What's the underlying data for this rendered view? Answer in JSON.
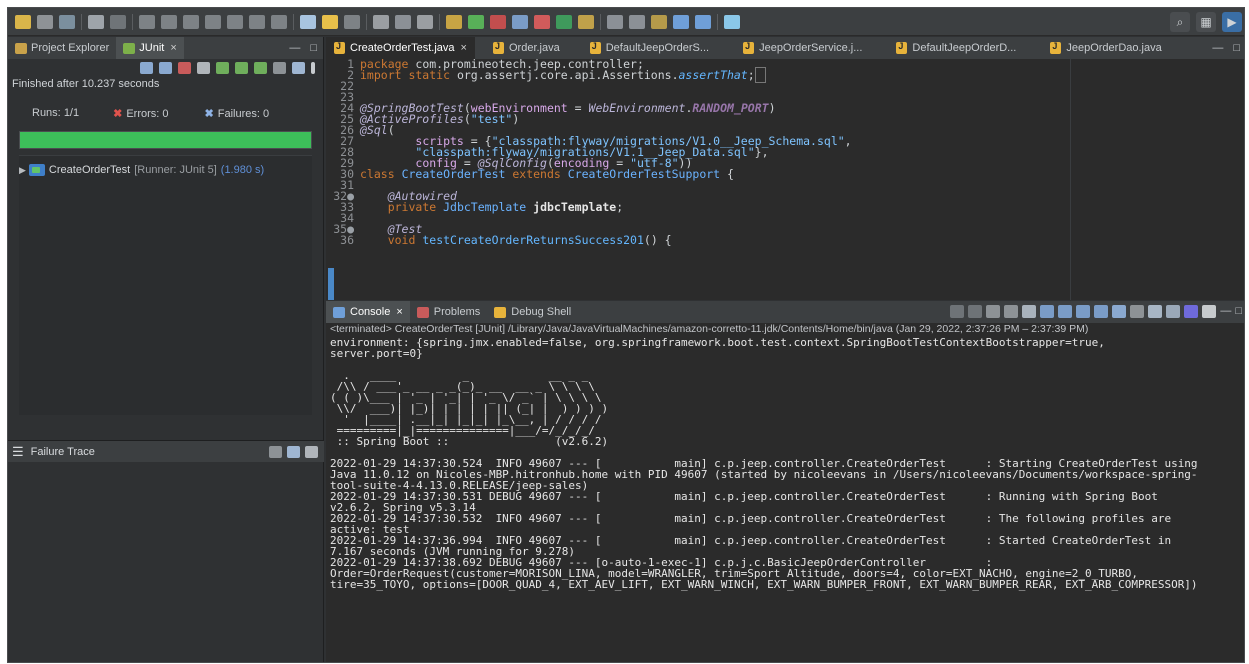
{
  "toolbar": {
    "search_icon": "search-icon",
    "perspective_icons": [
      "java-ee-perspective-icon",
      "debug-perspective-icon"
    ]
  },
  "left_panel": {
    "tabs": [
      {
        "label": "Project Explorer",
        "active": false
      },
      {
        "label": "JUnit",
        "active": true
      }
    ],
    "finished_text": "Finished after 10.237 seconds",
    "runs_label": "Runs:",
    "runs_value": "1/1",
    "errors_label": "Errors:",
    "errors_value": "0",
    "failures_label": "Failures:",
    "failures_value": "0",
    "progress_fraction": 1.0,
    "progress_color": "#3dbf5a",
    "test_name": "CreateOrderTest",
    "test_runner": "[Runner: JUnit 5]",
    "test_time": "(1.980 s)",
    "failure_trace_label": "Failure Trace"
  },
  "editor": {
    "tabs": [
      {
        "label": "CreateOrderTest.java",
        "active": true,
        "close": "×"
      },
      {
        "label": "Order.java",
        "active": false
      },
      {
        "label": "DefaultJeepOrderS...",
        "active": false
      },
      {
        "label": "JeepOrderService.j...",
        "active": false
      },
      {
        "label": "DefaultJeepOrderD...",
        "active": false
      },
      {
        "label": "JeepOrderDao.java",
        "active": false
      }
    ],
    "lines": [
      {
        "n": "1",
        "t": "package com.promineotech.jeep.controller;"
      },
      {
        "n": "2",
        "t": "import static org.assertj.core.api.Assertions.assertThat;"
      },
      {
        "n": "22",
        "t": ""
      },
      {
        "n": "23",
        "t": ""
      },
      {
        "n": "24",
        "t": "@SpringBootTest(webEnvironment = WebEnvironment.RANDOM_PORT)"
      },
      {
        "n": "25",
        "t": "@ActiveProfiles(\"test\")"
      },
      {
        "n": "26",
        "t": "@Sql("
      },
      {
        "n": "27",
        "t": "    scripts = {\"classpath:flyway/migrations/V1.0__Jeep_Schema.sql\","
      },
      {
        "n": "28",
        "t": "    \"classpath:flyway/migrations/V1.1__Jeep_Data.sql\"},"
      },
      {
        "n": "29",
        "t": "    config = @SqlConfig(encoding = \"utf-8\"))"
      },
      {
        "n": "30",
        "t": "class CreateOrderTest extends CreateOrderTestSupport {"
      },
      {
        "n": "31",
        "t": ""
      },
      {
        "n": "32",
        "t": "  @Autowired"
      },
      {
        "n": "33",
        "t": "  private JdbcTemplate jdbcTemplate;"
      },
      {
        "n": "34",
        "t": ""
      },
      {
        "n": "35",
        "t": "  @Test"
      },
      {
        "n": "36",
        "t": "  void testCreateOrderReturnsSuccess201() {"
      }
    ]
  },
  "console": {
    "tabs": [
      {
        "label": "Console",
        "active": true,
        "close": "×"
      },
      {
        "label": "Problems",
        "active": false
      },
      {
        "label": "Debug Shell",
        "active": false
      }
    ],
    "status": "<terminated> CreateOrderTest [JUnit] /Library/Java/JavaVirtualMachines/amazon-corretto-11.jdk/Contents/Home/bin/java  (Jan 29, 2022, 2:37:26 PM – 2:37:39 PM)",
    "lines": [
      "environment: {spring.jmx.enabled=false, org.springframework.boot.test.context.SpringBootTestContextBootstrapper=true,",
      "server.port=0}",
      "",
      "  .   ____          _            __ _ _",
      " /\\\\ / ___'_ __ _ _(_)_ __  __ _ \\ \\ \\ \\",
      "( ( )\\___ | '_ | '_| | '_ \\/ _` | \\ \\ \\ \\",
      " \\\\/  ___)| |_)| | | | | || (_| |  ) ) ) )",
      "  '  |____| .__|_| |_|_| |_\\__, | / / / /",
      " =========|_|==============|___/=/_/_/_/",
      " :: Spring Boot ::                (v2.6.2)",
      "",
      "2022-01-29 14:37:30.524  INFO 49607 --- [           main] c.p.jeep.controller.CreateOrderTest      : Starting CreateOrderTest using",
      "Java 11.0.12 on Nicoles-MBP.hitronhub.home with PID 49607 (started by nicoleevans in /Users/nicoleevans/Documents/workspace-spring-",
      "tool-suite-4-4.13.0.RELEASE/jeep-sales)",
      "2022-01-29 14:37:30.531 DEBUG 49607 --- [           main] c.p.jeep.controller.CreateOrderTest      : Running with Spring Boot",
      "v2.6.2, Spring v5.3.14",
      "2022-01-29 14:37:30.532  INFO 49607 --- [           main] c.p.jeep.controller.CreateOrderTest      : The following profiles are",
      "active: test",
      "2022-01-29 14:37:36.994  INFO 49607 --- [           main] c.p.jeep.controller.CreateOrderTest      : Started CreateOrderTest in",
      "7.167 seconds (JVM running for 9.278)",
      "2022-01-29 14:37:38.692 DEBUG 49607 --- [o-auto-1-exec-1] c.p.j.c.BasicJeepOrderController         :",
      "Order=OrderRequest(customer=MORISON_LINA, model=WRANGLER, trim=Sport Altitude, doors=4, color=EXT_NACHO, engine=2_0_TURBO,",
      "tire=35_TOYO, options=[DOOR_QUAD_4, EXT_AEV_LIFT, EXT_WARN_WINCH, EXT_WARN_BUMPER_FRONT, EXT_WARN_BUMPER_REAR, EXT_ARB_COMPRESSOR])"
    ]
  }
}
